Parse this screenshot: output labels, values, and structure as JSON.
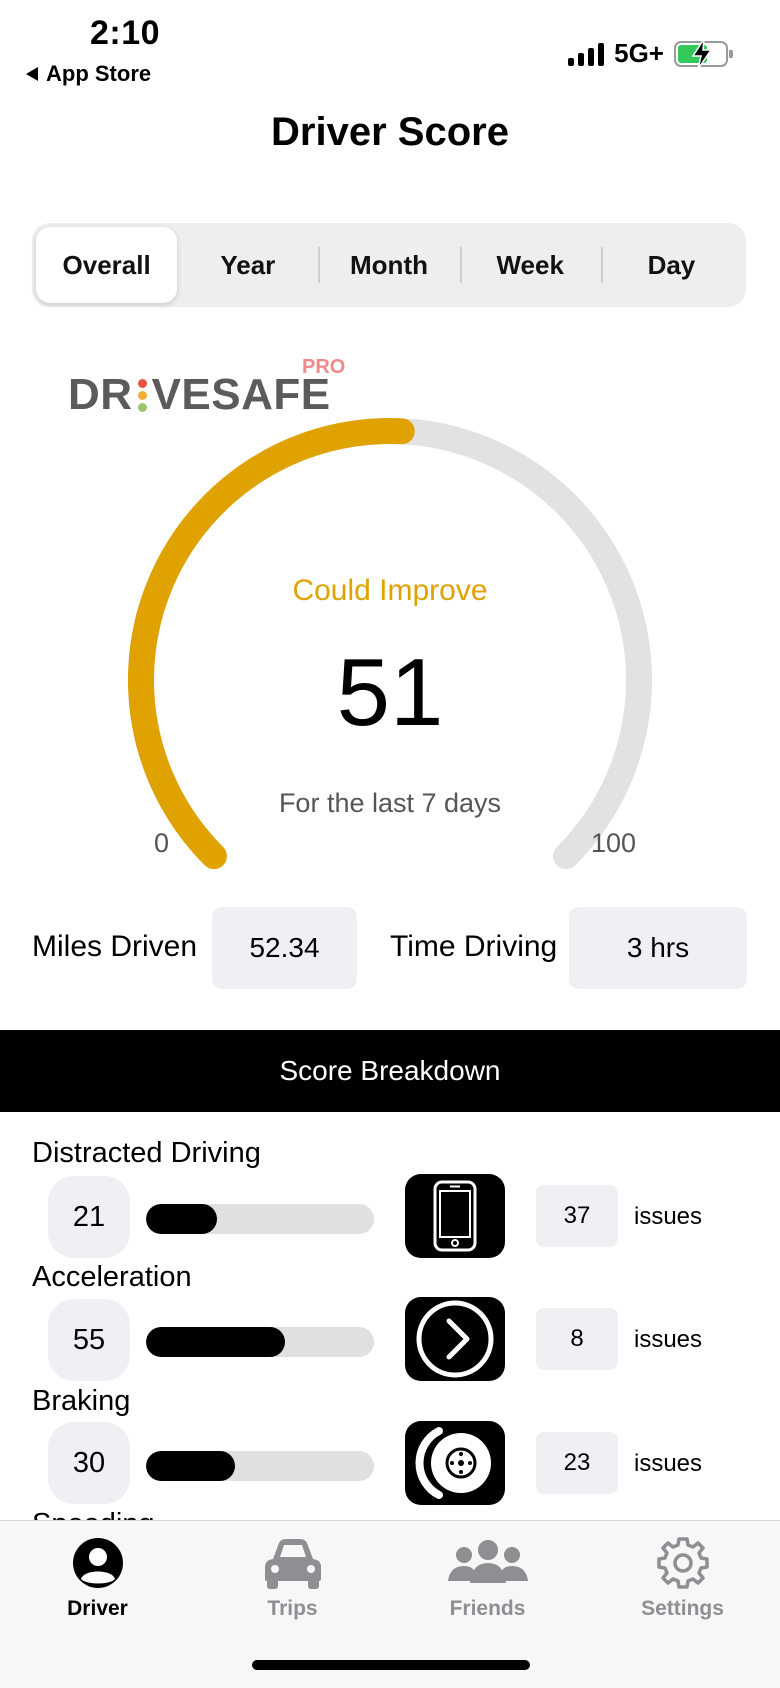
{
  "status_bar": {
    "time": "2:10",
    "back_label": "App Store",
    "network": "5G+"
  },
  "page_title": "Driver Score",
  "segments": [
    {
      "label": "Overall",
      "active": true
    },
    {
      "label": "Year",
      "active": false
    },
    {
      "label": "Month",
      "active": false
    },
    {
      "label": "Week",
      "active": false
    },
    {
      "label": "Day",
      "active": false
    }
  ],
  "logo": {
    "text_left": "DR",
    "text_right": "VESAFE",
    "badge": "PRO"
  },
  "gauge": {
    "status": "Could Improve",
    "score": 51,
    "score_text": "51",
    "period": "For the last 7 days",
    "min_label": "0",
    "max_label": "100",
    "min": 0,
    "max": 100,
    "color": "#e0a200",
    "track_color": "#e2e2e2"
  },
  "stats": {
    "miles_label": "Miles Driven",
    "miles_value": "52.34",
    "time_label": "Time Driving",
    "time_value": "3 hrs"
  },
  "breakdown": {
    "header": "Score Breakdown",
    "items": [
      {
        "title": "Distracted Driving",
        "score": "21",
        "fill": 0.31,
        "icon": "phone-icon",
        "count": "37",
        "unit": "issues"
      },
      {
        "title": "Acceleration",
        "score": "55",
        "fill": 0.61,
        "icon": "acceleration-icon",
        "count": "8",
        "unit": "issues"
      },
      {
        "title": "Braking",
        "score": "30",
        "fill": 0.39,
        "icon": "brake-disc-icon",
        "count": "23",
        "unit": "issues"
      },
      {
        "title": "Speeding"
      }
    ]
  },
  "tabbar": {
    "items": [
      {
        "label": "Driver",
        "icon": "person-icon",
        "active": true
      },
      {
        "label": "Trips",
        "icon": "car-icon",
        "active": false
      },
      {
        "label": "Friends",
        "icon": "people-icon",
        "active": false
      },
      {
        "label": "Settings",
        "icon": "gear-icon",
        "active": false
      }
    ]
  }
}
